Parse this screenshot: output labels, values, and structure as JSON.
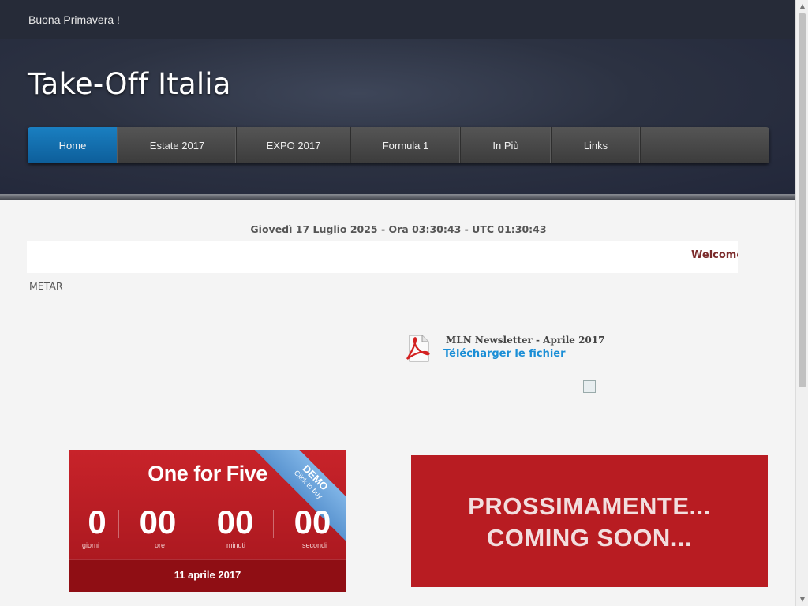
{
  "topbar": {
    "message": "Buona Primavera !"
  },
  "header": {
    "site_title": "Take-Off Italia"
  },
  "nav": {
    "items": [
      {
        "label": "Home",
        "active": true
      },
      {
        "label": "Estate 2017"
      },
      {
        "label": "EXPO 2017"
      },
      {
        "label": "Formula 1"
      },
      {
        "label": "In Più"
      },
      {
        "label": "Links"
      }
    ]
  },
  "content": {
    "date_line": "Giovedì 17 Luglio 2025 - Ora 03:30:43 - UTC 01:30:43",
    "marquee_text": "Welcome",
    "metar_label": "METAR",
    "newsletter": {
      "title": "MLN Newsletter - Aprile 2017",
      "download_link": "Télécharger le fichier",
      "icon": "pdf-icon"
    }
  },
  "countdown": {
    "title": "One for Five",
    "ribbon_main": "DEMO",
    "ribbon_sub": "Click to buy",
    "units": [
      {
        "value": "0",
        "label": "giorni"
      },
      {
        "value": "00",
        "label": "ore"
      },
      {
        "value": "00",
        "label": "minuti"
      },
      {
        "value": "00",
        "label": "secondi"
      }
    ],
    "target_date": "11 aprile 2017"
  },
  "banner": {
    "line1": "PROSSIMAMENTE...",
    "line2": "COMING SOON..."
  },
  "colors": {
    "nav_active": "#1a7fc1",
    "countdown_red": "#c8232a",
    "banner_red": "#b81c22",
    "link_blue": "#1a8ed6"
  }
}
